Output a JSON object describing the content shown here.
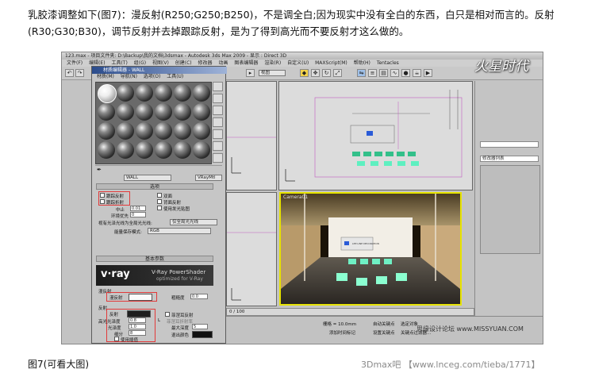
{
  "article": {
    "paragraph": "乳胶漆调整如下(图7)：漫反射(R250;G250;B250)，不是调全白;因为现实中没有全白的东西，白只是相对而言的。反射(R30;G30;B30)，调节反射并去掉跟踪反射，是为了得到高光而不要反射才这么做的。",
    "caption": "图7(可看大图)",
    "footer": "3Dmax吧 【www.lnceg.com/tieba/1771】"
  },
  "app": {
    "title": "123.max - 项目文件夹: D:\\Backup\\我的文档\\3dsmax - Autodesk 3ds Max 2009 - 显示 : Direct 3D",
    "menu": [
      "文件(F)",
      "编辑(E)",
      "工具(T)",
      "组(G)",
      "视图(V)",
      "创建(C)",
      "修改器",
      "动画",
      "图表编辑器",
      "渲染(R)",
      "自定义(U)",
      "MAXScript(M)",
      "帮助(H)",
      "Tentacles"
    ],
    "viewport_dropdown": "视图",
    "logo": "火星时代",
    "right_panel": {
      "name_field": "",
      "modifier_list": "修改器列表"
    },
    "viewport_label": "Camera01",
    "screen_text": "LEE LINE DECORATION",
    "watermark": "思缘设计论坛 www.MISSYUAN.COM",
    "status": {
      "grid": "栅格 = 10.0mm",
      "auto_key": "自动关键点",
      "set_key": "设置关键点",
      "selected": "选定对象",
      "key_filter": "关键点过滤器...",
      "add_time_tag": "添加时间标记",
      "frame": "0 / 100"
    }
  },
  "material_editor": {
    "title": "材质编辑器 - WALL",
    "menu": [
      "材质(M)",
      "导航(N)",
      "选项(O)",
      "工具(U)"
    ],
    "material_name": "WALL",
    "material_type": "VRayMtl",
    "rollout_options": "选项",
    "rollout_basic": "基本参数",
    "options": {
      "trace_reflections": "跟踪反射",
      "trace_refractions": "跟踪折射",
      "cutoff_label": "中止",
      "cutoff_value": "0.01",
      "env_priority_label": "环境优先",
      "env_priority_value": "0",
      "double_sided": "双面",
      "reflect_backside": "背面反射",
      "use_irradiance_map": "使用发光贴图",
      "treat_glossy_label": "视有光泽光线为全局光光线:",
      "treat_glossy_value": "仅全局光光线",
      "energy_label": "能量保存模式:",
      "energy_value": "RGB"
    },
    "vray": {
      "logo": "v·ray",
      "line1": "V-Ray PowerShader",
      "line2": "optimized for V-Ray"
    },
    "diffuse": {
      "group": "漫反射",
      "label": "漫反射",
      "roughness_label": "粗糙度",
      "roughness_value": "0.0",
      "swatch": "#fafafa"
    },
    "reflection": {
      "group": "反射",
      "label": "反射",
      "swatch": "#1e1e1e",
      "hilight_gloss_label": "高光光泽度",
      "hilight_gloss_value": "0.8",
      "refl_gloss_label": "光泽度",
      "refl_gloss_value": "1.0",
      "subdivs_label": "细分",
      "subdivs_value": "8",
      "use_interp": "使用插值",
      "fresnel": "菲涅耳反射",
      "fresnel_ior_label": "菲涅耳折射率",
      "max_depth_label": "最大深度",
      "max_depth_value": "5",
      "exit_color_label": "退出颜色",
      "lock": "L"
    }
  },
  "colors": {
    "accent_red": "#e23a3a",
    "render_frame": "#e7e300",
    "title_blue": "#2b4c8c"
  }
}
